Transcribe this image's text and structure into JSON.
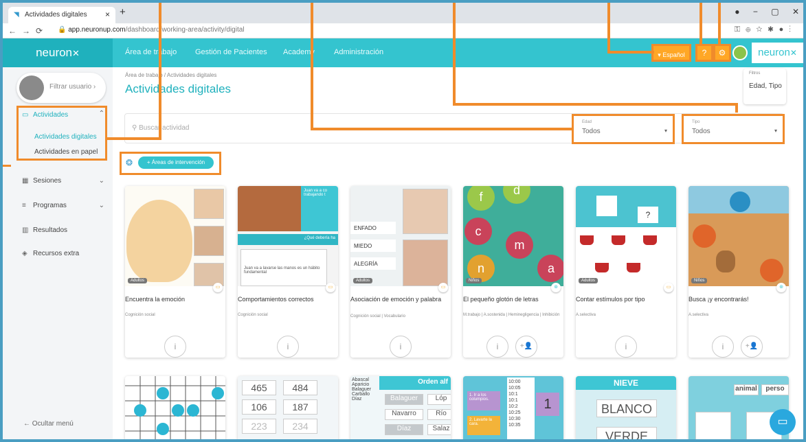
{
  "browser": {
    "tab_title": "Actividades digitales",
    "tab_close": "×",
    "new_tab": "+",
    "url_host": "app.neuronup.com",
    "url_path": "/dashboard/working-area/activity/digital",
    "window_controls": [
      "−",
      "▢",
      "✕"
    ]
  },
  "header": {
    "logo": "neuron",
    "nav": [
      "Área de trabajo",
      "Gestión de Pacientes",
      "Academy",
      "Administración"
    ],
    "language": "Español",
    "help_icon": "?",
    "settings_icon": "⚙",
    "logo_right": "neuron"
  },
  "sidebar": {
    "filter_user": "Filtrar usuario",
    "items": [
      {
        "label": "Actividades",
        "icon": "▭"
      },
      {
        "label": "Actividades digitales"
      },
      {
        "label": "Actividades en papel"
      },
      {
        "label": "Sesiones",
        "icon": "▦"
      },
      {
        "label": "Programas",
        "icon": "≡"
      },
      {
        "label": "Resultados",
        "icon": "▥"
      },
      {
        "label": "Recursos extra",
        "icon": "◈"
      }
    ],
    "hide_menu": "Ocultar menú"
  },
  "main": {
    "breadcrumb": "Área de trabajo / Actividades digitales",
    "title": "Actividades digitales",
    "filters_label": "Filtros",
    "filters_value": "Edad, Tipo",
    "search_placeholder": "Buscar actividad",
    "edad_label": "Edad",
    "edad_value": "Todos",
    "tipo_label": "Tipo",
    "tipo_value": "Todos",
    "areas_button": "+ Áreas de intervención"
  },
  "cards": [
    {
      "title": "Encuentra la emoción",
      "tags": "Cognición social",
      "badge": "Adultos",
      "color": "#f3b339"
    },
    {
      "title": "Comportamientos correctos",
      "tags": "Cognición social",
      "badge": "Adultos",
      "color": "#f3b339"
    },
    {
      "title": "Asociación de emoción y palabra",
      "tags": "Cognición social | Vocabulario",
      "badge": "Adultos",
      "color": "#f3b339"
    },
    {
      "title": "El pequeño glotón de letras",
      "tags": "M.trabajo | A.sostenida | Heminegligencia | Inhibición",
      "badge": "Niños",
      "color": "#34c4cf"
    },
    {
      "title": "Contar estímulos por tipo",
      "tags": "A.selectiva",
      "badge": "Adultos",
      "color": "#f3b339"
    },
    {
      "title": "Busca ¡y encontrarás!",
      "tags": "A.selectiva",
      "badge": "Niños",
      "color": "#34c4cf"
    }
  ],
  "card_texts": {
    "c2_a": "Juan va a co trabajando t",
    "c2_q": "¿Qué debería ha",
    "c2_b": "Juan va a lavarse las manos es un hábito fundamental",
    "c3_words": [
      "ENFADO",
      "MIEDO",
      "ALEGRÍA"
    ],
    "c4_letters": [
      "f",
      "d",
      "c",
      "m",
      "n",
      "a"
    ],
    "c6_tile": "?",
    "row2_nums": [
      "465",
      "484",
      "106",
      "187",
      "223",
      "234"
    ],
    "row2_names": [
      "Abascal",
      "Aparicio",
      "Balaguer",
      "Carballo",
      "Díaz"
    ],
    "row2_order": "Orden alf",
    "row2_opts": [
      "Balaguer",
      "Lóp",
      "Navarro",
      "Río",
      "Díaz",
      "Salaz"
    ],
    "row2_times": [
      "10:00",
      "10:05",
      "10:1",
      "10:1",
      "10:2",
      "10:25",
      "10:30",
      "10:35"
    ],
    "row2_tasks": [
      "1. Ir a los columpios.",
      "2. Lavarte la cara."
    ],
    "row2_big": "1",
    "row2_nieve": "NIEVE",
    "row2_words": [
      "BLANCO",
      "VERDE"
    ],
    "row2_anim": "animal",
    "row2_pers": "perso"
  },
  "accent": "#34c4cf",
  "annotation_color": "#f08b2b"
}
